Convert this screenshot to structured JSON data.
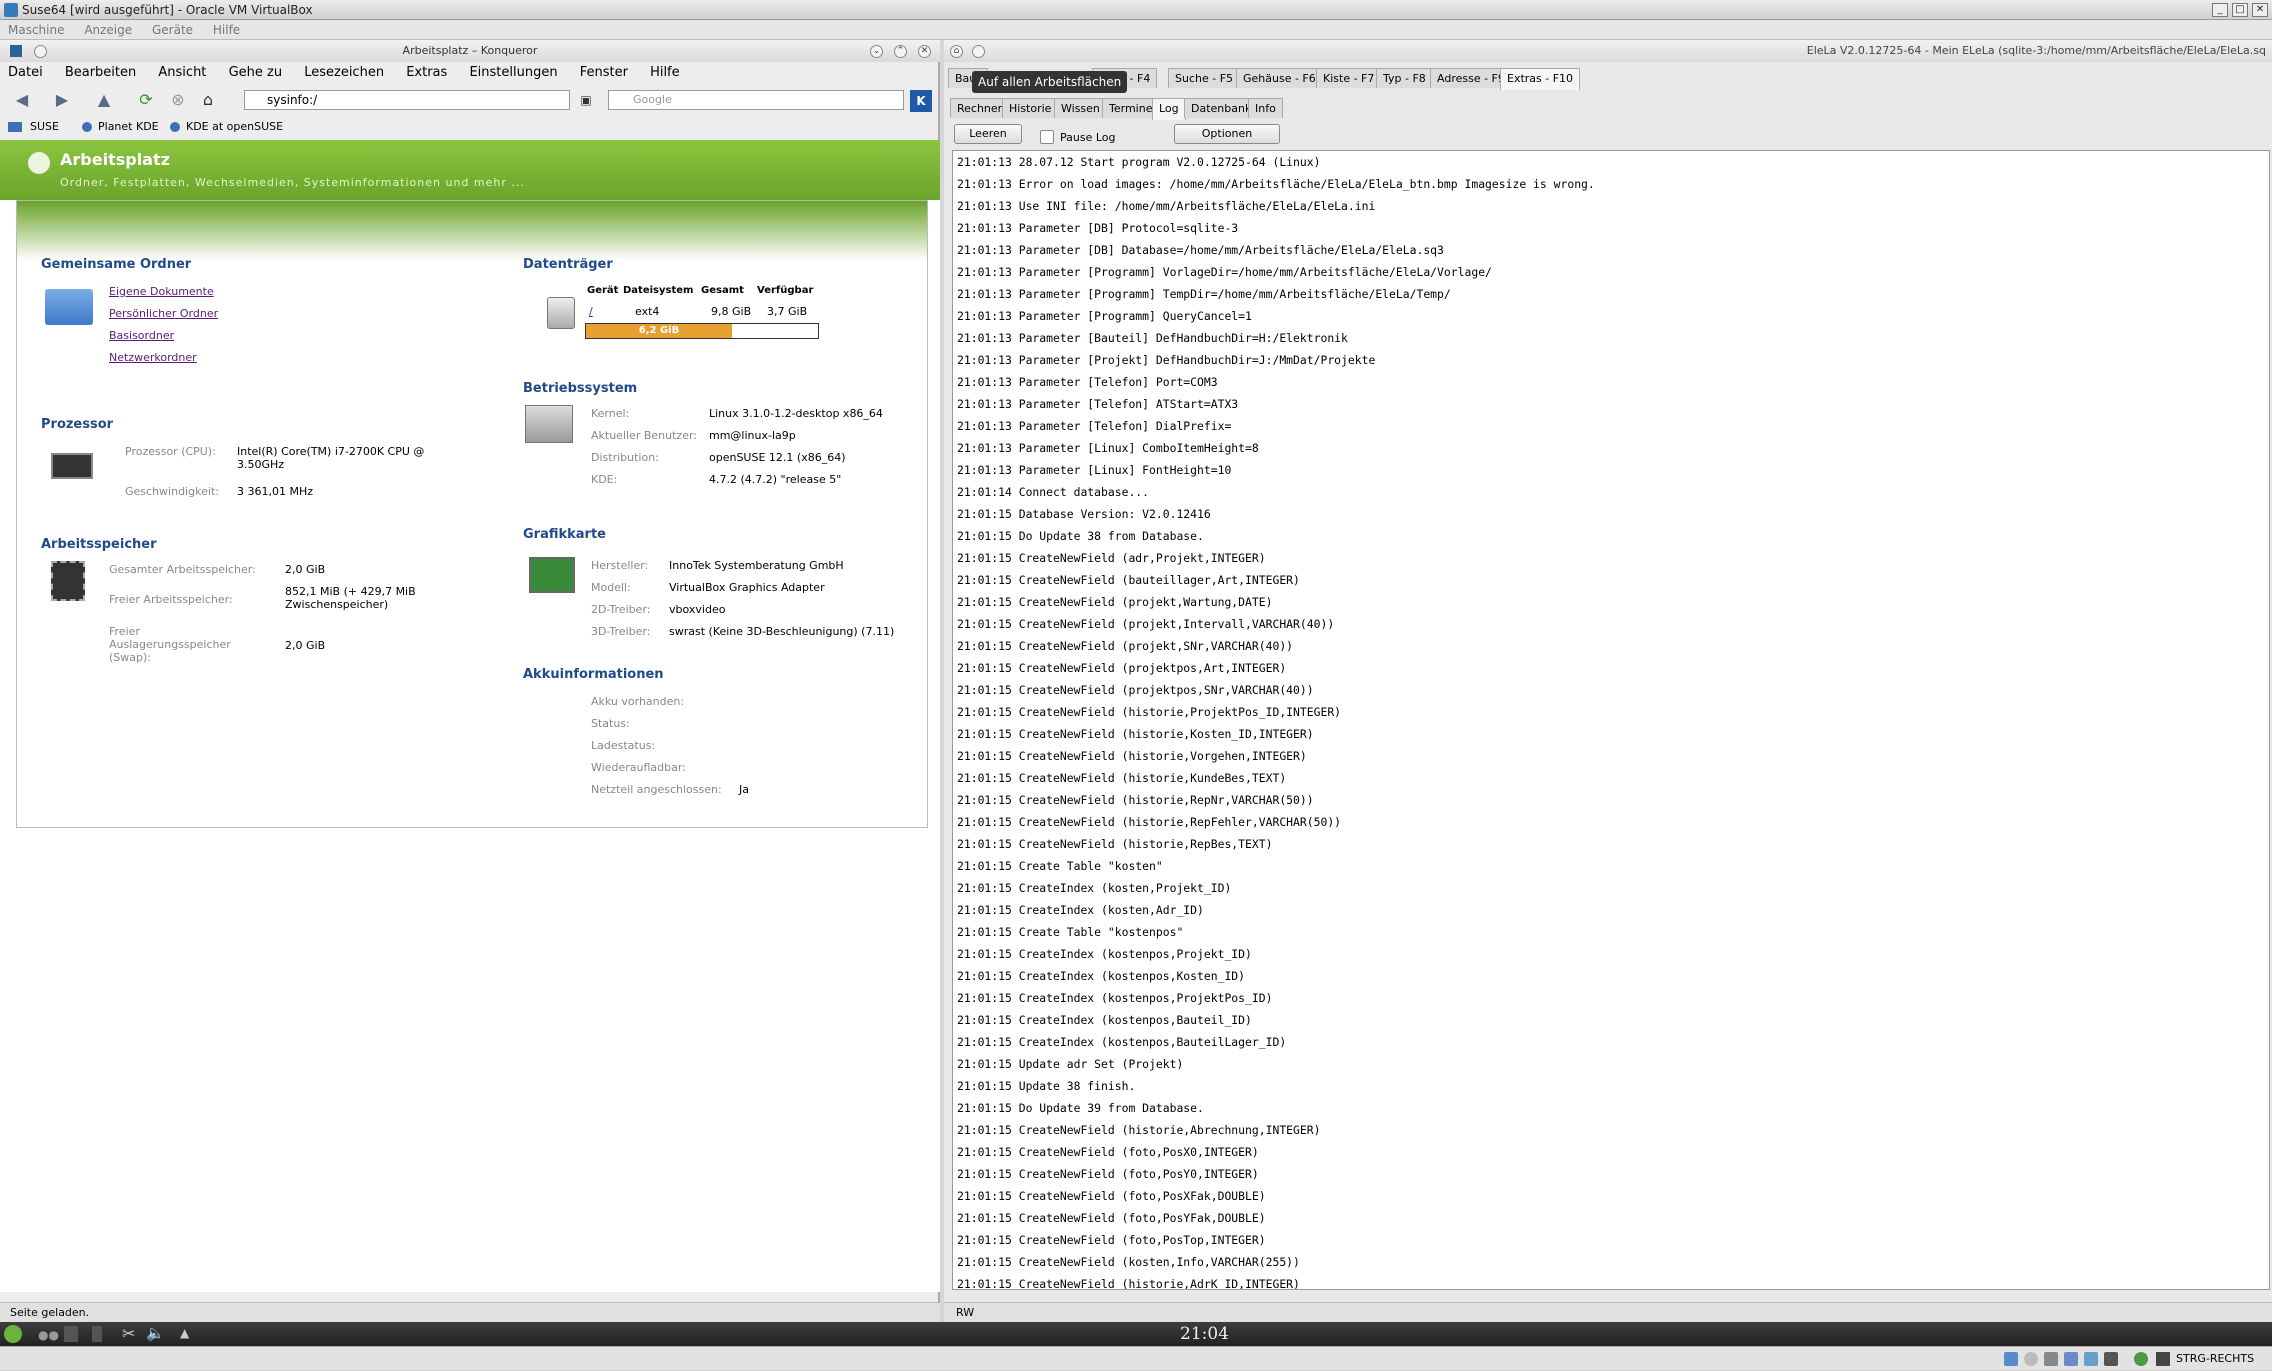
{
  "vbox": {
    "title": "Suse64 [wird ausgeführt] - Oracle VM VirtualBox",
    "menu": [
      "Maschine",
      "Anzeige",
      "Geräte",
      "Hilfe"
    ],
    "status_right": "STRG-RECHTS"
  },
  "konqueror": {
    "title": "Arbeitsplatz – Konqueror",
    "menu": [
      "Datei",
      "Bearbeiten",
      "Ansicht",
      "Gehe zu",
      "Lesezeichen",
      "Extras",
      "Einstellungen",
      "Fenster",
      "Hilfe"
    ],
    "url": "sysinfo:/",
    "search_placeholder": "Google",
    "bookmarks": [
      "SUSE",
      "Planet KDE",
      "KDE at openSUSE"
    ],
    "status": "Seite geladen."
  },
  "sysinfo": {
    "title": "Arbeitsplatz",
    "subtitle": "Ordner, Festplatten, Wechselmedien, Systeminformationen und mehr ...",
    "shared": {
      "heading": "Gemeinsame Ordner",
      "links": [
        "Eigene Dokumente",
        "Persönlicher Ordner",
        "Basisordner",
        "Netzwerkordner"
      ]
    },
    "cpu": {
      "heading": "Prozessor",
      "label_cpu": "Prozessor (CPU):",
      "value_cpu": "Intel(R) Core(TM) i7-2700K CPU @ 3.50GHz",
      "label_speed": "Geschwindigkeit:",
      "value_speed": "3 361,01 MHz"
    },
    "memory": {
      "heading": "Arbeitsspeicher",
      "label_total": "Gesamter Arbeitsspeicher:",
      "value_total": "2,0 GiB",
      "label_free": "Freier Arbeitsspeicher:",
      "value_free": "852,1 MiB (+ 429,7 MiB Zwischenspeicher)",
      "label_swap": "Freier Auslagerungsspeicher (Swap):",
      "value_swap": "2,0 GiB"
    },
    "storage": {
      "heading": "Datenträger",
      "col_device": "Gerät",
      "col_fs": "Dateisystem",
      "col_total": "Gesamt",
      "col_avail": "Verfügbar",
      "device": "/",
      "fs": "ext4",
      "total": "9,8 GiB",
      "avail": "3,7 GiB",
      "used_label": "6,2 GiB",
      "used_fraction": 0.63
    },
    "os": {
      "heading": "Betriebssystem",
      "label_kernel": "Kernel:",
      "value_kernel": "Linux 3.1.0-1.2-desktop x86_64",
      "label_user": "Aktueller Benutzer:",
      "value_user": "mm@linux-la9p",
      "label_dist": "Distribution:",
      "value_dist": "openSUSE 12.1 (x86_64)",
      "label_kde": "KDE:",
      "value_kde": "4.7.2 (4.7.2) \"release 5\""
    },
    "gpu": {
      "heading": "Grafikkarte",
      "label_vendor": "Hersteller:",
      "value_vendor": "InnoTek Systemberatung GmbH",
      "label_model": "Modell:",
      "value_model": "VirtualBox Graphics Adapter",
      "label_2d": "2D-Treiber:",
      "value_2d": "vboxvideo",
      "label_3d": "3D-Treiber:",
      "value_3d": "swrast (Keine 3D-Beschleunigung) (7.11)"
    },
    "battery": {
      "heading": "Akkuinformationen",
      "label_present": "Akku vorhanden:",
      "label_status": "Status:",
      "label_charge": "Ladestatus:",
      "label_recharge": "Wiederaufladbar:",
      "label_ac": "Netzteil angeschlossen:",
      "value_ac": "Ja"
    }
  },
  "elela": {
    "title": "ElеLa V2.0.12725-64 - Mein ELeLa (sqlite-3:/home/mm/Arbeitsfläche/EleLa/EleLa.sq",
    "tooltip": "Auf allen Arbeitsflächen",
    "tabs_top": [
      "Baut",
      "llung - F4",
      "Suche - F5",
      "Gehäuse - F6",
      "Kiste - F7",
      "Typ - F8",
      "Adresse - F9",
      "Extras - F10"
    ],
    "tabs_sub": [
      "Rechner",
      "Historie",
      "Wissen",
      "Termine",
      "Log",
      "Datenbank",
      "Info"
    ],
    "btn_clear": "Leeren",
    "chk_pause": "Pause Log",
    "btn_options": "Optionen",
    "status": "RW",
    "log": [
      "21:01:13 28.07.12 Start program V2.0.12725-64 (Linux)",
      "21:01:13 Error on load images: /home/mm/Arbeitsfläche/EleLa/EleLa_btn.bmp Imagesize is wrong.",
      "21:01:13 Use INI file: /home/mm/Arbeitsfläche/EleLa/EleLa.ini",
      "21:01:13 Parameter [DB] Protocol=sqlite-3",
      "21:01:13 Parameter [DB] Database=/home/mm/Arbeitsfläche/EleLa/EleLa.sq3",
      "21:01:13 Parameter [Programm] VorlageDir=/home/mm/Arbeitsfläche/EleLa/Vorlage/",
      "21:01:13 Parameter [Programm] TempDir=/home/mm/Arbeitsfläche/EleLa/Temp/",
      "21:01:13 Parameter [Programm] QueryCancel=1",
      "21:01:13 Parameter [Bauteil] DefHandbuchDir=H:/Elektronik",
      "21:01:13 Parameter [Projekt] DefHandbuchDir=J:/MmDat/Projekte",
      "21:01:13 Parameter [Telefon] Port=COM3",
      "21:01:13 Parameter [Telefon] ATStart=ATX3",
      "21:01:13 Parameter [Telefon] DialPrefix=",
      "21:01:13 Parameter [Linux] ComboItemHeight=8",
      "21:01:13 Parameter [Linux] FontHeight=10",
      "21:01:14 Connect database...",
      "21:01:15 Database Version: V2.0.12416",
      "21:01:15 Do Update 38 from Database.",
      "21:01:15 CreateNewField (adr,Projekt,INTEGER)",
      "21:01:15 CreateNewField (bauteillager,Art,INTEGER)",
      "21:01:15 CreateNewField (projekt,Wartung,DATE)",
      "21:01:15 CreateNewField (projekt,Intervall,VARCHAR(40))",
      "21:01:15 CreateNewField (projekt,SNr,VARCHAR(40))",
      "21:01:15 CreateNewField (projektpos,Art,INTEGER)",
      "21:01:15 CreateNewField (projektpos,SNr,VARCHAR(40))",
      "21:01:15 CreateNewField (historie,ProjektPos_ID,INTEGER)",
      "21:01:15 CreateNewField (historie,Kosten_ID,INTEGER)",
      "21:01:15 CreateNewField (historie,Vorgehen,INTEGER)",
      "21:01:15 CreateNewField (historie,KundeBes,TEXT)",
      "21:01:15 CreateNewField (historie,RepNr,VARCHAR(50))",
      "21:01:15 CreateNewField (historie,RepFehler,VARCHAR(50))",
      "21:01:15 CreateNewField (historie,RepBes,TEXT)",
      "21:01:15 Create Table \"kosten\"",
      "21:01:15 CreateIndex (kosten,Projekt_ID)",
      "21:01:15 CreateIndex (kosten,Adr_ID)",
      "21:01:15 Create Table \"kostenpos\"",
      "21:01:15 CreateIndex (kostenpos,Projekt_ID)",
      "21:01:15 CreateIndex (kostenpos,Kosten_ID)",
      "21:01:15 CreateIndex (kostenpos,ProjektPos_ID)",
      "21:01:15 CreateIndex (kostenpos,Bauteil_ID)",
      "21:01:15 CreateIndex (kostenpos,BauteilLager_ID)",
      "21:01:15 Update adr Set (Projekt)",
      "21:01:15 Update 38 finish.",
      "21:01:15 Do Update 39 from Database.",
      "21:01:15 CreateNewField (historie,Abrechnung,INTEGER)",
      "21:01:15 CreateNewField (foto,PosX0,INTEGER)",
      "21:01:15 CreateNewField (foto,PosY0,INTEGER)",
      "21:01:15 CreateNewField (foto,PosXFak,DOUBLE)",
      "21:01:15 CreateNewField (foto,PosYFak,DOUBLE)",
      "21:01:15 CreateNewField (foto,PosTop,INTEGER)",
      "21:01:15 CreateNewField (kosten,Info,VARCHAR(255))",
      "21:01:15 CreateNewField (historie,AdrK_ID,INTEGER)"
    ]
  },
  "taskbar": {
    "clock": "21:04"
  }
}
